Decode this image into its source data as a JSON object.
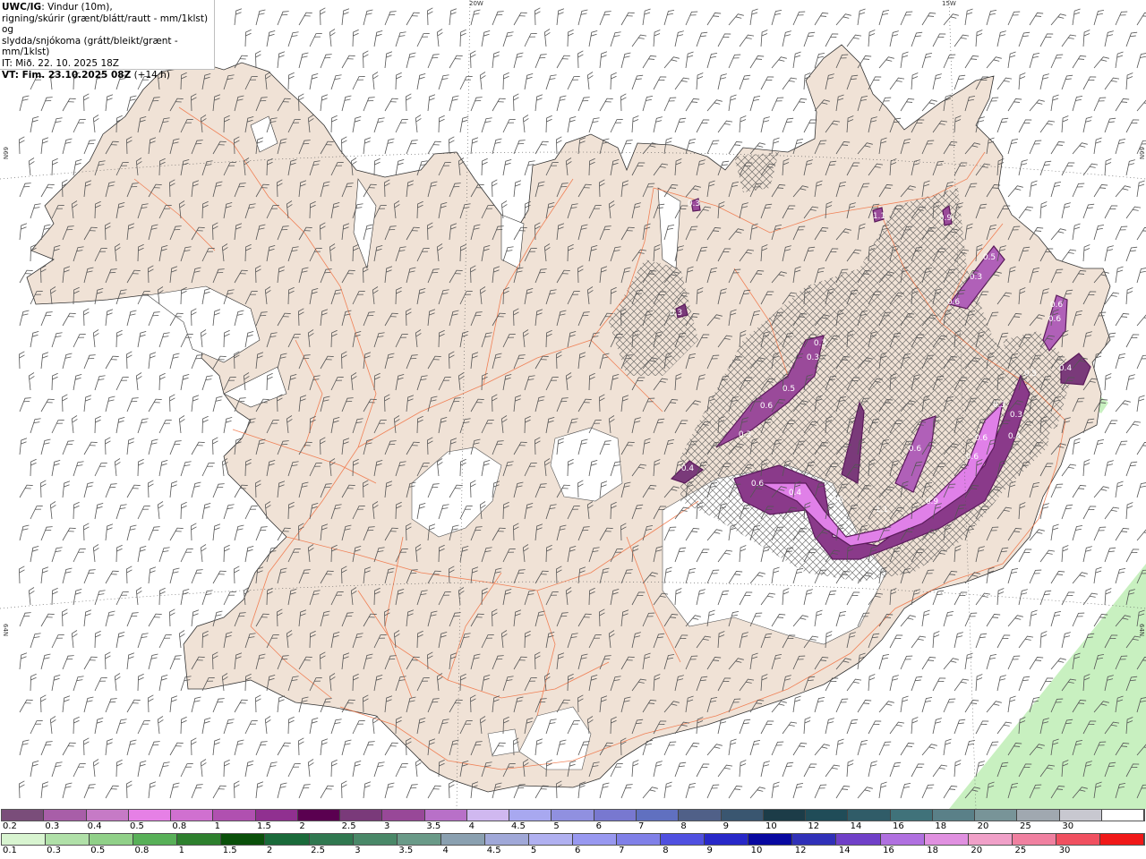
{
  "info": {
    "line1_bold": "UWC/IG",
    "line1_rest": ": Vindur (10m),",
    "line2": "rigning/skúrir (grænt/blátt/rautt - mm/1klst) og",
    "line3": "slydda/snjókoma (grátt/bleikt/grænt - mm/1klst)",
    "line4": "IT: Mið. 22. 10. 2025 18Z",
    "line5_bold": "VT: Fim. 23.10.2025 08Z",
    "line5_rest": " (+14 h)"
  },
  "grid_labels": {
    "top_left": "20W",
    "top_right": "15W",
    "left_upper": "66N",
    "left_lower": "64N",
    "right_upper": "66N",
    "right_lower": "64N"
  },
  "colors": {
    "land": "#f0e2d6",
    "roads": "#f07040",
    "glacier": "#ffffff",
    "sea": "#ffffff",
    "snow_purple": "#c040c0",
    "rain_green": "#c8f0c0"
  },
  "precip_labels": [
    "0.5",
    "0.3",
    "0.3",
    "0.3",
    "1.1",
    "0.9",
    "0.6",
    "0.6",
    "0.6",
    "0.3",
    "0.3",
    "0.5",
    "0.6",
    "0.3",
    "0.4",
    "0.5",
    "0.3",
    "0.4",
    "0.4",
    "0.6",
    "1.1",
    "0.6",
    "0.9",
    "0.6",
    "0.6",
    "0.6",
    "0.3",
    "0.4"
  ],
  "scale_snow": {
    "colors": [
      "#7a4d7a",
      "#a85ea8",
      "#c67ac6",
      "#e680e6",
      "#d070d0",
      "#b050b0",
      "#903090",
      "#5a0050",
      "#7a3a7a",
      "#984898",
      "#b870c8",
      "#d0b8f0",
      "#a8a8f0",
      "#9090e0",
      "#7878d0",
      "#6070c0",
      "#506088",
      "#3a5670",
      "#1c3c48",
      "#204c58",
      "#305c68",
      "#40727a",
      "#5a8088",
      "#789498",
      "#a0a8b0",
      "#c8c8d0",
      "#ffffff"
    ],
    "labels": [
      "0.2",
      "0.3",
      "0.4",
      "0.5",
      "0.8",
      "1",
      "1.5",
      "2",
      "2.5",
      "3",
      "3.5",
      "4",
      "4.5",
      "5",
      "6",
      "7",
      "8",
      "9",
      "10",
      "12",
      "14",
      "16",
      "18",
      "20",
      "25",
      "30"
    ]
  },
  "scale_rain": {
    "colors": [
      "#d8f4d0",
      "#b0e0a8",
      "#90d088",
      "#58b058",
      "#2e802e",
      "#0a500a",
      "#1a6a3a",
      "#307850",
      "#4a8868",
      "#6a9a88",
      "#8aa0b0",
      "#a0a8d8",
      "#b0b0f0",
      "#9898f0",
      "#8080e8",
      "#5050e0",
      "#2828c8",
      "#0808a0",
      "#3030b8",
      "#7040c8",
      "#b070e0",
      "#e090e0",
      "#f0a0c8",
      "#f080a0",
      "#f05060",
      "#f01818"
    ],
    "labels": [
      "0.1",
      "0.3",
      "0.5",
      "0.8",
      "1",
      "1.5",
      "2",
      "2.5",
      "3",
      "3.5",
      "4",
      "4.5",
      "5",
      "6",
      "7",
      "8",
      "9",
      "10",
      "12",
      "14",
      "16",
      "18",
      "20",
      "25",
      "30"
    ]
  }
}
